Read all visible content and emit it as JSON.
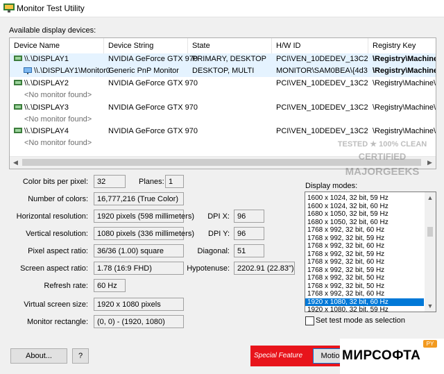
{
  "window": {
    "title": "Monitor Test Utility",
    "icon": "monitor-app-icon"
  },
  "devices_label": "Available display devices:",
  "columns": [
    "Device Name",
    "Device String",
    "State",
    "H/W ID",
    "Registry Key"
  ],
  "devices": [
    {
      "name": "\\\\.\\DISPLAY1",
      "string": "NVIDIA GeForce GTX 970",
      "state": "PRIMARY, DESKTOP",
      "hwid": "PCI\\VEN_10DEDEV_13C2SUB...",
      "reg": "\\Registry\\Machine\\Sy"
    },
    {
      "name": "\\\\.\\DISPLAY1\\Monitor0",
      "string": "Generic PnP Monitor",
      "state": "DESKTOP, MULTI",
      "hwid": "MONITOR\\SAM0BEA\\{4d36e...",
      "reg": "\\Registry\\Machine\\Sy"
    },
    {
      "name": "\\\\.\\DISPLAY2",
      "string": "NVIDIA GeForce GTX 970",
      "state": "",
      "hwid": "PCI\\VEN_10DEDEV_13C2SUB...",
      "reg": "\\Registry\\Machine\\Sy"
    },
    {
      "name": "<No monitor found>"
    },
    {
      "name": "\\\\.\\DISPLAY3",
      "string": "NVIDIA GeForce GTX 970",
      "state": "",
      "hwid": "PCI\\VEN_10DEDEV_13C2SUB...",
      "reg": "\\Registry\\Machine\\Sy"
    },
    {
      "name": "<No monitor found>"
    },
    {
      "name": "\\\\.\\DISPLAY4",
      "string": "NVIDIA GeForce GTX 970",
      "state": "",
      "hwid": "PCI\\VEN_10DEDEV_13C2SUB...",
      "reg": "\\Registry\\Machine\\Sy"
    },
    {
      "name": "<No monitor found>"
    }
  ],
  "props": {
    "color_bits_label": "Color bits per pixel:",
    "color_bits": "32",
    "planes_label": "Planes:",
    "planes": "1",
    "num_colors_label": "Number of colors:",
    "num_colors": "16,777,216 (True Color)",
    "hres_label": "Horizontal resolution:",
    "hres": "1920 pixels (598 millimeters)",
    "vres_label": "Vertical resolution:",
    "vres": "1080 pixels (336 millimeters)",
    "pix_aspect_label": "Pixel aspect ratio:",
    "pix_aspect": "36/36 (1.00) square",
    "screen_aspect_label": "Screen aspect ratio:",
    "screen_aspect": "1.78 (16:9 FHD)",
    "refresh_label": "Refresh rate:",
    "refresh": "60 Hz",
    "virtual_label": "Virtual screen size:",
    "virtual": "1920 x 1080 pixels",
    "rect_label": "Monitor rectangle:",
    "rect": "(0, 0) - (1920, 1080)",
    "dpix_label": "DPI X:",
    "dpix": "96",
    "dpiy_label": "DPI Y:",
    "dpiy": "96",
    "diagonal_label": "Diagonal:",
    "diagonal": "51",
    "hyp_label": "Hypotenuse:",
    "hyp": "2202.91 (22.83\")"
  },
  "modes_label": "Display modes:",
  "modes": [
    "1600 x 1024, 32 bit, 59 Hz",
    "1600 x 1024, 32 bit, 60 Hz",
    "1680 x 1050, 32 bit, 59 Hz",
    "1680 x 1050, 32 bit, 60 Hz",
    "1768 x 992, 32 bit, 60 Hz",
    "1768 x 992, 32 bit, 59 Hz",
    "1768 x 992, 32 bit, 60 Hz",
    "1768 x 992, 32 bit, 59 Hz",
    "1768 x 992, 32 bit, 60 Hz",
    "1768 x 992, 32 bit, 59 Hz",
    "1768 x 992, 32 bit, 50 Hz",
    "1768 x 992, 32 bit, 50 Hz",
    "1768 x 992, 32 bit, 60 Hz",
    "1920 x 1080, 32 bit, 60 Hz",
    "1920 x 1080, 32 bit, 59 Hz"
  ],
  "selected_mode": 13,
  "test_mode_label": "Set test mode as selection",
  "buttons": {
    "about": "About...",
    "help": "?",
    "motion": "Motio"
  },
  "special_feature": "Special Feature",
  "watermark1": [
    "TESTED ★ 100% CLEAN",
    "CERTIFIED",
    "MAJORGEEKS"
  ],
  "watermark2": {
    "text": "МИРСОФТА",
    "badge": "PY"
  },
  "colors": {
    "selection": "#0078d7",
    "special": "#e8141b",
    "row_highlight": "#e5f3ff"
  }
}
